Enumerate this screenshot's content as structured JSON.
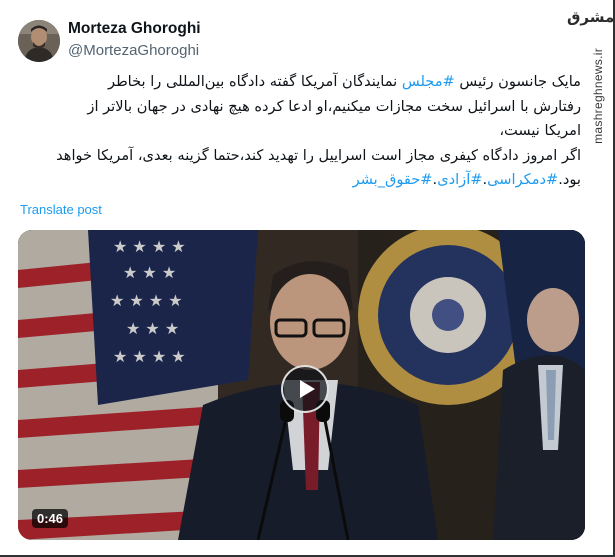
{
  "author": {
    "name": "Morteza Ghoroghi",
    "handle": "@MortezaGhoroghi"
  },
  "watermark": {
    "logo": "مشرق",
    "site": "mashreghnews.ir"
  },
  "tweet": {
    "line1_text": "مایک جانسون رئیس ",
    "line1_tag": "#مجلس",
    "line1_rest": " نمایندگان آمریکا گفته دادگاه بین‌المللی را بخاطر",
    "line2": "رفتارش با اسرائیل سخت مجازات میکنیم،او ادعا کرده هیچ نهادی در جهان بالاتر از",
    "line3": "امریکا نیست،",
    "line4": "اگر امروز دادگاه کیفری مجاز است اسراییل را تهدید کند،حتما گزینه بعدی، آمریکا خواهد",
    "line5_text": "بود.",
    "tags": [
      "#دمکراسی",
      "#آزادی",
      "#حقوق_بشر"
    ]
  },
  "translate_label": "Translate post",
  "video": {
    "duration": "0:46"
  },
  "icons": {
    "avatar": "avatar",
    "play": "play-icon"
  },
  "colors": {
    "link": "#1d9bf0",
    "text": "#0f1419",
    "muted": "#536471"
  }
}
